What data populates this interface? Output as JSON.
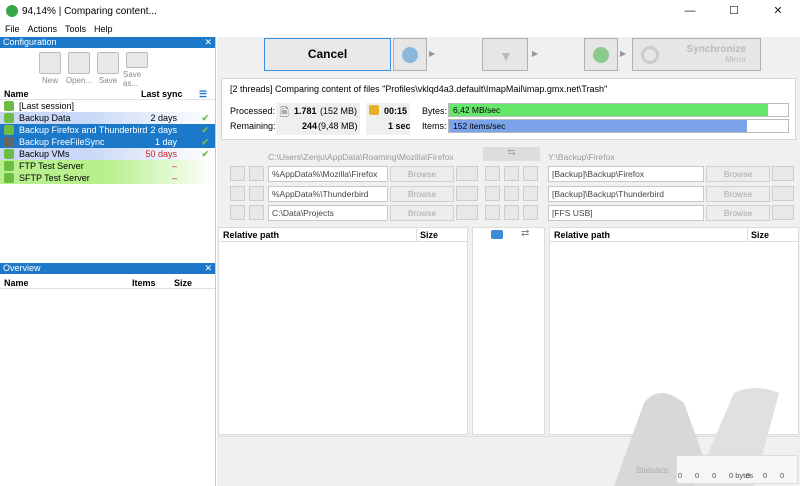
{
  "window": {
    "title": "94,14% | Comparing content...",
    "minimize": "—",
    "maximize": "☐",
    "close": "✕"
  },
  "menu": [
    "File",
    "Actions",
    "Tools",
    "Help"
  ],
  "config": {
    "header": "Configuration",
    "close": "✕",
    "toolbar": [
      {
        "label": "New",
        "icon": "new-file-icon"
      },
      {
        "label": "Open...",
        "icon": "open-folder-icon"
      },
      {
        "label": "Save",
        "icon": "save-icon"
      },
      {
        "label": "Save as...",
        "icon": "save-as-icon"
      }
    ],
    "columns": {
      "name": "Name",
      "last_sync": "Last sync"
    },
    "rows": [
      {
        "name": "[Last session]",
        "last_sync": "",
        "checked": false
      },
      {
        "name": "Backup Data",
        "last_sync": "2 days",
        "checked": true
      },
      {
        "name": "Backup Firefox and Thunderbird",
        "last_sync": "2 days",
        "checked": true
      },
      {
        "name": "Backup FreeFileSync",
        "last_sync": "1 day",
        "checked": true
      },
      {
        "name": "Backup VMs",
        "last_sync": "50 days",
        "checked": true
      },
      {
        "name": "FTP Test Server",
        "last_sync": "–",
        "checked": false
      },
      {
        "name": "SFTP Test Server",
        "last_sync": "–",
        "checked": false
      }
    ]
  },
  "overview": {
    "header": "Overview",
    "close": "✕",
    "columns": {
      "name": "Name",
      "items": "Items",
      "size": "Size"
    }
  },
  "actions": {
    "cancel": "Cancel",
    "synchronize": "Synchronize",
    "synchronize_sub": "Mirror"
  },
  "status": {
    "message": "[2 threads] Comparing content of files \"Profiles\\vklqd4a3.default\\ImapMail\\imap.gmx.net\\Trash\"",
    "processed_label": "Processed:",
    "processed_count": "1.781",
    "processed_size": "(152 MB)",
    "remaining_label": "Remaining:",
    "remaining_count": "244",
    "remaining_size": "(9,48 MB)",
    "elapsed": "00:15",
    "remaining_time": "1 sec",
    "bytes_label": "Bytes:",
    "bytes_rate": "6,42 MB/sec",
    "bytes_progress": 0.94,
    "items_label": "Items:",
    "items_rate": "152 items/sec",
    "items_progress": 0.88
  },
  "folders": {
    "left_root": "C:\\Users\\Zenju\\AppData\\Roaming\\Mozilla\\Firefox",
    "right_root": "Y:\\Backup\\Firefox",
    "swap": "⇆",
    "pairs": [
      {
        "left": "%AppData%\\Mozilla\\Firefox",
        "right": "[Backup]\\Backup\\Firefox"
      },
      {
        "left": "%AppData%\\Thunderbird",
        "right": "[Backup]\\Backup\\Thunderbird"
      },
      {
        "left": "C:\\Data\\Projects",
        "right": "[FFS USB]"
      }
    ],
    "browse": "Browse"
  },
  "grid": {
    "left_col": "Relative path",
    "left_size": "Size",
    "right_col": "Relative path",
    "right_size": "Size"
  },
  "statistics": {
    "label": "Statistics:",
    "values": [
      "0",
      "0",
      "0",
      "0 bytes",
      "0",
      "0",
      "0"
    ]
  }
}
